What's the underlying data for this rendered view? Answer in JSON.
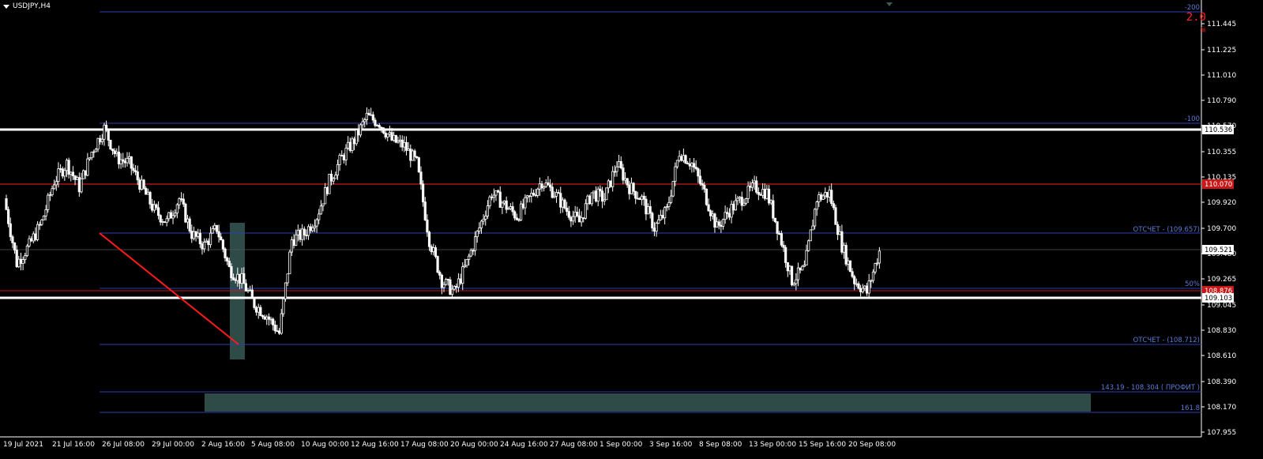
{
  "symbol": {
    "label": "USDJPY,H4"
  },
  "price_axis": {
    "ticks": [
      "111.445",
      "111.225",
      "111.010",
      "110.790",
      "110.570",
      "110.355",
      "110.135",
      "109.920",
      "109.700",
      "109.480",
      "109.265",
      "109.045",
      "108.830",
      "108.610",
      "108.390",
      "108.170",
      "107.955"
    ],
    "current_price": "109.521",
    "level_high": "110.536",
    "level_red": "110.070",
    "level_fib50": "108.876",
    "level_low": "109.103"
  },
  "time_axis": {
    "labels": [
      "19 Jul 2021",
      "21 Jul 16:00",
      "26 Jul 08:00",
      "29 Jul 00:00",
      "2 Aug 16:00",
      "5 Aug 08:00",
      "10 Aug 00:00",
      "12 Aug 16:00",
      "17 Aug 08:00",
      "20 Aug 00:00",
      "24 Aug 16:00",
      "27 Aug 08:00",
      "1 Sep 00:00",
      "3 Sep 16:00",
      "8 Sep 08:00",
      "13 Sep 00:00",
      "15 Sep 16:00",
      "20 Sep 08:00"
    ]
  },
  "fib_labels": {
    "minus200": "-200",
    "minus100": "-100",
    "report_upper": "ОТСЧЕТ - (109.657)",
    "fifty": "50%",
    "report_lower": "ОТСЧЕТ - (108.712)",
    "profit": "143.19 -  108.304 ( ПРОФИТ )",
    "f1618": "161.8"
  },
  "risk_indicator": {
    "value": "2.0",
    "icon": "skull-crossbones-icon"
  },
  "colors": {
    "background": "#000000",
    "candle": "#ffffff",
    "fib_line": "#2a3fb4",
    "fib_text": "#5b7bd6",
    "red_line": "#c81818",
    "white_level": "#ffffff",
    "zone_fill": "#2f4b47",
    "risk_red": "#ff2020"
  },
  "chart_data": {
    "type": "candlestick",
    "symbol": "USDJPY",
    "timeframe": "H4",
    "ylim": [
      107.955,
      111.56
    ],
    "current_price": 109.521,
    "horizontal_levels": [
      {
        "label": "110.536",
        "price": 110.536,
        "color": "#ffffff"
      },
      {
        "label": "110.070",
        "price": 110.07,
        "color": "#c81818"
      },
      {
        "label": "109.103",
        "price": 109.103,
        "color": "#ffffff"
      },
      {
        "label": "108.876",
        "price": 108.876,
        "color": "#c81818"
      }
    ],
    "closes": [
      109.95,
      109.4,
      109.55,
      109.75,
      110.1,
      110.25,
      110.05,
      110.35,
      110.55,
      110.3,
      110.25,
      110.05,
      109.85,
      109.75,
      109.95,
      109.65,
      109.55,
      109.7,
      109.35,
      109.25,
      109.05,
      108.95,
      108.8,
      109.6,
      109.65,
      109.8,
      110.1,
      110.3,
      110.45,
      110.65,
      110.6,
      110.45,
      110.4,
      110.25,
      109.6,
      109.25,
      109.15,
      109.4,
      109.7,
      110.0,
      109.9,
      109.8,
      109.95,
      110.1,
      110.0,
      109.85,
      109.75,
      110.0,
      109.95,
      110.25,
      110.05,
      109.95,
      109.7,
      109.85,
      110.35,
      110.25,
      110.0,
      109.7,
      109.85,
      109.95,
      110.05,
      110.0,
      109.65,
      109.25,
      109.35,
      109.95,
      110.0,
      109.55,
      109.25,
      109.15,
      109.5
    ]
  }
}
